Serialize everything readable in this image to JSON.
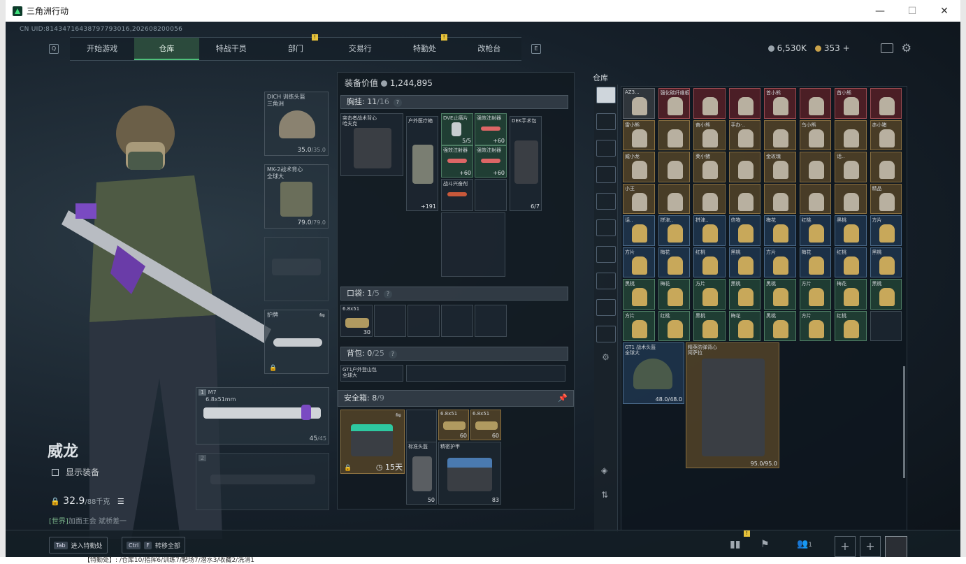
{
  "window": {
    "title": "三角洲行动",
    "minimize": "—",
    "maximize": "☐",
    "close": "✕"
  },
  "uid": "CN UID:8143471643879779301​6,202608200056",
  "nav": {
    "key_left": "Q",
    "key_right": "E",
    "tabs": [
      {
        "label": "开始游戏",
        "active": false,
        "alert": false
      },
      {
        "label": "仓库",
        "active": true,
        "alert": false
      },
      {
        "label": "特战干员",
        "active": false,
        "alert": false
      },
      {
        "label": "部门",
        "active": false,
        "alert": true
      },
      {
        "label": "交易行",
        "active": false,
        "alert": false
      },
      {
        "label": "特勤处",
        "active": false,
        "alert": true
      },
      {
        "label": "改枪台",
        "active": false,
        "alert": false
      }
    ]
  },
  "currency": {
    "silver": "6,530K",
    "gold": "353",
    "plus": "+",
    "alert": "!"
  },
  "character": {
    "name": "威龙",
    "show_gear": "显示装备",
    "weight": "32.9",
    "weight_max": "/88千克",
    "world_msg_tag": "[世界]",
    "world_msg": "加面王会 斌桥差一"
  },
  "gear": {
    "helmet": {
      "name": "DICH 训练头盔",
      "sub": "三角洲",
      "dur": "35.0",
      "max": "/35.0"
    },
    "armor": {
      "name": "MK-2战术背心",
      "sub": "全球大",
      "dur": "79.0",
      "max": "/79.0"
    },
    "melee": {
      "name": "护牌"
    },
    "weapon1": {
      "slot": "1",
      "name": "M7",
      "caliber": "6.8x51mm",
      "ammo": "45",
      "max": "/45"
    },
    "weapon2": {
      "slot": "2"
    }
  },
  "loadout": {
    "value_label": "装备价值",
    "value": "1,244,895",
    "chest": {
      "label": "胸挂:",
      "used": "11",
      "cap": "/16",
      "q": "?"
    },
    "chest_items": [
      {
        "name": "突击者战术背心",
        "sub": "哈夫克"
      },
      {
        "name": "户外医疗箱",
        "n": "+191"
      },
      {
        "name": "DVE止痛片",
        "n": "5/5"
      },
      {
        "name": "强效注射器",
        "n": "+60"
      },
      {
        "name": "强效注射器",
        "n": "+60"
      },
      {
        "name": "强效注射器",
        "n": "+60"
      },
      {
        "name": "DEK手术包",
        "n": "6/7"
      },
      {
        "name": "战斗兴奋剂",
        "n": ""
      }
    ],
    "pocket": {
      "label": "口袋:",
      "used": "1",
      "cap": "/5",
      "q": "?"
    },
    "pocket_item": {
      "name": "6.8x51",
      "n": "30"
    },
    "bag": {
      "label": "背包:",
      "used": "0",
      "cap": "/25",
      "q": "?"
    },
    "bag_item": {
      "name": "GT1户外登山包",
      "sub": "全球大"
    },
    "safe": {
      "label": "安全箱:",
      "used": "8",
      "cap": "/9",
      "timer": "15天"
    },
    "safe_items": [
      {
        "name": "6.8x51",
        "n": "60"
      },
      {
        "name": "6.8x51",
        "n": "60"
      },
      {
        "name": "标准头盔",
        "n": "50"
      },
      {
        "name": "精密护甲",
        "n": "83"
      }
    ]
  },
  "storage": {
    "title": "仓库",
    "cells": [
      {
        "t": "AZ3...",
        "c": "gr"
      },
      {
        "t": "强化碳纤维板",
        "c": "r"
      },
      {
        "t": "",
        "c": "r"
      },
      {
        "t": "",
        "c": "r"
      },
      {
        "t": "首小熊",
        "c": "r"
      },
      {
        "t": "",
        "c": "r"
      },
      {
        "t": "首小熊",
        "c": "r"
      },
      {
        "t": "",
        "c": "r"
      },
      {
        "t": "雷小熊",
        "c": "y"
      },
      {
        "t": "",
        "c": "y"
      },
      {
        "t": "奋小熊",
        "c": "y"
      },
      {
        "t": "手办·..",
        "c": "y"
      },
      {
        "t": "",
        "c": "y"
      },
      {
        "t": "乌小熊",
        "c": "y"
      },
      {
        "t": "",
        "c": "y"
      },
      {
        "t": "赤小猪",
        "c": "y"
      },
      {
        "t": "威小龙",
        "c": "y"
      },
      {
        "t": "",
        "c": "y"
      },
      {
        "t": "荚小猪",
        "c": "y"
      },
      {
        "t": "",
        "c": "y"
      },
      {
        "t": "金玫瑰",
        "c": "y"
      },
      {
        "t": "",
        "c": "y"
      },
      {
        "t": "话..",
        "c": "y"
      },
      {
        "t": "",
        "c": "y"
      },
      {
        "t": "小王",
        "c": "y"
      },
      {
        "t": "",
        "c": "y"
      },
      {
        "t": "",
        "c": "y"
      },
      {
        "t": "",
        "c": "y"
      },
      {
        "t": "",
        "c": "y"
      },
      {
        "t": "",
        "c": "y"
      },
      {
        "t": "",
        "c": "y"
      },
      {
        "t": "精品",
        "c": "y"
      },
      {
        "t": "话..",
        "c": "b"
      },
      {
        "t": "拼津..",
        "c": "b"
      },
      {
        "t": "拼津..",
        "c": "b"
      },
      {
        "t": "信物",
        "c": "b"
      },
      {
        "t": "梅花",
        "c": "b"
      },
      {
        "t": "红桃",
        "c": "b"
      },
      {
        "t": "黑桃",
        "c": "b"
      },
      {
        "t": "方片",
        "c": "b"
      },
      {
        "t": "方片",
        "c": "b"
      },
      {
        "t": "梅花",
        "c": "b"
      },
      {
        "t": "红桃",
        "c": "b"
      },
      {
        "t": "黑桃",
        "c": "b"
      },
      {
        "t": "方片",
        "c": "b"
      },
      {
        "t": "梅花",
        "c": "b"
      },
      {
        "t": "红桃",
        "c": "b"
      },
      {
        "t": "黑桃",
        "c": "b"
      },
      {
        "t": "黑桃",
        "c": "g"
      },
      {
        "t": "梅花",
        "c": "g"
      },
      {
        "t": "方片",
        "c": "g"
      },
      {
        "t": "黑桃",
        "c": "g"
      },
      {
        "t": "黑桃",
        "c": "g"
      },
      {
        "t": "方片",
        "c": "g"
      },
      {
        "t": "梅花",
        "c": "g"
      },
      {
        "t": "黑桃",
        "c": "g"
      },
      {
        "t": "方片",
        "c": "g"
      },
      {
        "t": "红桃",
        "c": "g"
      },
      {
        "t": "黑桃",
        "c": "g"
      },
      {
        "t": "梅花",
        "c": "g"
      },
      {
        "t": "黑桃",
        "c": "g"
      },
      {
        "t": "方片",
        "c": "g"
      },
      {
        "t": "红桃",
        "c": "g"
      },
      {
        "t": "",
        "c": ""
      }
    ],
    "helmet": {
      "name": "GT1 战术头盔",
      "sub": "全球大",
      "dur": "48.0/48.0"
    },
    "armor": {
      "name": "精英防弹背心",
      "sub": "阿萨拉",
      "dur": "95.0/95.0"
    }
  },
  "bottom": {
    "tab_key": "Tab",
    "tab_label": "进入特勤处",
    "ctrl_key": "Ctrl",
    "f_key": "F",
    "transfer_label": "转移全部",
    "friends": "1"
  },
  "statusbar": "【特勤处】: /仓库10/指挥6/训练7/靶场7/潜水3/收藏2/洗消1"
}
